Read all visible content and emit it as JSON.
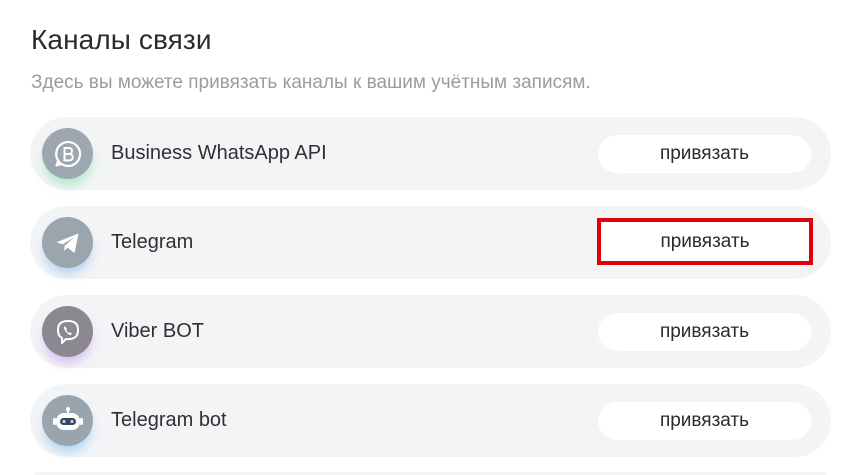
{
  "page": {
    "title": "Каналы связи",
    "subtitle": "Здесь вы можете привязать каналы к вашим учётным записям."
  },
  "channels": [
    {
      "name": "Business WhatsApp API",
      "icon": "whatsapp-business-icon",
      "button_label": "привязать",
      "highlighted": false
    },
    {
      "name": "Telegram",
      "icon": "telegram-icon",
      "button_label": "привязать",
      "highlighted": true
    },
    {
      "name": "Viber BOT",
      "icon": "viber-icon",
      "button_label": "привязать",
      "highlighted": false
    },
    {
      "name": "Telegram bot",
      "icon": "robot-icon",
      "button_label": "привязать",
      "highlighted": false
    }
  ],
  "colors": {
    "row_background": "#f3f4f6",
    "highlight": "#e0000a",
    "text": "#2b2b2f",
    "muted_text": "#9a9ca3"
  }
}
